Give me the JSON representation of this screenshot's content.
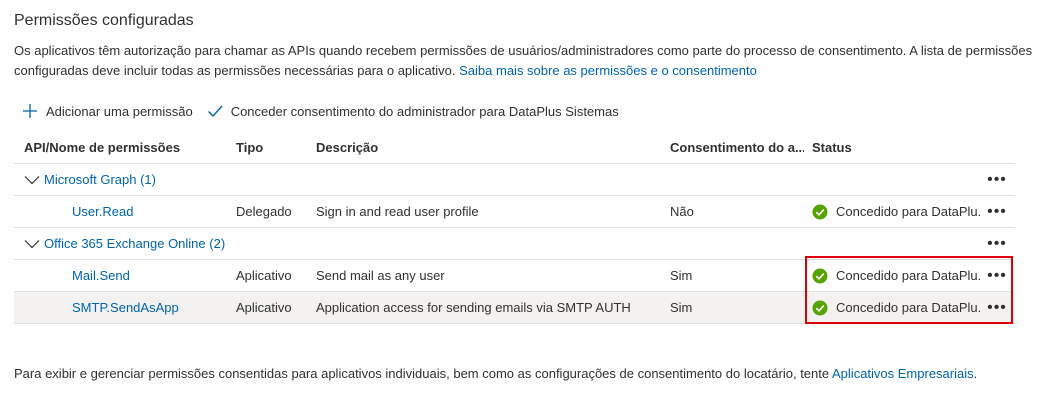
{
  "section": {
    "title": "Permissões configuradas",
    "description": "Os aplicativos têm autorização para chamar as APIs quando recebem permissões de usuários/administradores como parte do processo de consentimento. A lista de permissões configuradas deve incluir todas as permissões necessárias para o aplicativo.",
    "learn_more_link": "Saiba mais sobre as permissões e o consentimento"
  },
  "toolbar": {
    "add_permission": "Adicionar uma permissão",
    "grant_consent": "Conceder consentimento do administrador para DataPlus Sistemas"
  },
  "table": {
    "headers": {
      "api": "API/Nome de permissões",
      "type": "Tipo",
      "description": "Descrição",
      "consent": "Consentimento do a...",
      "status": "Status"
    },
    "groups": [
      {
        "name": "Microsoft Graph (1)",
        "permissions": [
          {
            "name": "User.Read",
            "type": "Delegado",
            "description": "Sign in and read user profile",
            "consent": "Não",
            "status": "Concedido para DataPlu..."
          }
        ]
      },
      {
        "name": "Office 365 Exchange Online (2)",
        "permissions": [
          {
            "name": "Mail.Send",
            "type": "Aplicativo",
            "description": "Send mail as any user",
            "consent": "Sim",
            "status": "Concedido para DataPlu..."
          },
          {
            "name": "SMTP.SendAsApp",
            "type": "Aplicativo",
            "description": "Application access for sending emails via SMTP AUTH",
            "consent": "Sim",
            "status": "Concedido para DataPlu..."
          }
        ]
      }
    ],
    "more": "•••"
  },
  "footer": {
    "text": "Para exibir e gerenciar permissões consentidas para aplicativos individuais, bem como as configurações de consentimento do locatário, tente ",
    "link": "Aplicativos Empresariais",
    "end": "."
  },
  "colors": {
    "link": "#0063b1",
    "success": "#57a300",
    "highlight": "#e0000b"
  }
}
